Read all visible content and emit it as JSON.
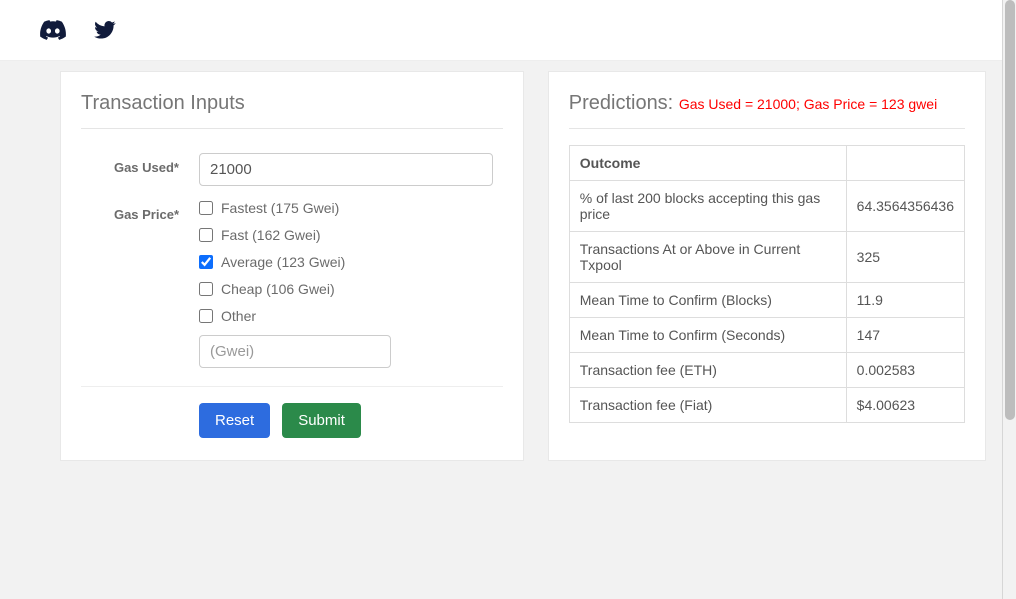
{
  "left": {
    "title": "Transaction Inputs",
    "gas_used_label": "Gas Used*",
    "gas_used_value": "21000",
    "gas_price_label": "Gas Price*",
    "options": {
      "fastest": "Fastest (175 Gwei)",
      "fast": "Fast (162 Gwei)",
      "average": "Average (123 Gwei)",
      "cheap": "Cheap (106 Gwei)",
      "other": "Other"
    },
    "other_placeholder": "(Gwei)",
    "buttons": {
      "reset": "Reset",
      "submit": "Submit"
    }
  },
  "right": {
    "title": "Predictions:",
    "subtitle": "Gas Used = 21000; Gas Price = 123 gwei",
    "header_outcome": "Outcome",
    "rows": [
      {
        "label": "% of last 200 blocks accepting this gas price",
        "value": "64.3564356436"
      },
      {
        "label": "Transactions At or Above in Current Txpool",
        "value": "325"
      },
      {
        "label": "Mean Time to Confirm (Blocks)",
        "value": "11.9"
      },
      {
        "label": "Mean Time to Confirm (Seconds)",
        "value": "147"
      },
      {
        "label": "Transaction fee (ETH)",
        "value": "0.002583"
      },
      {
        "label": "Transaction fee (Fiat)",
        "value": "$4.00623"
      }
    ]
  }
}
